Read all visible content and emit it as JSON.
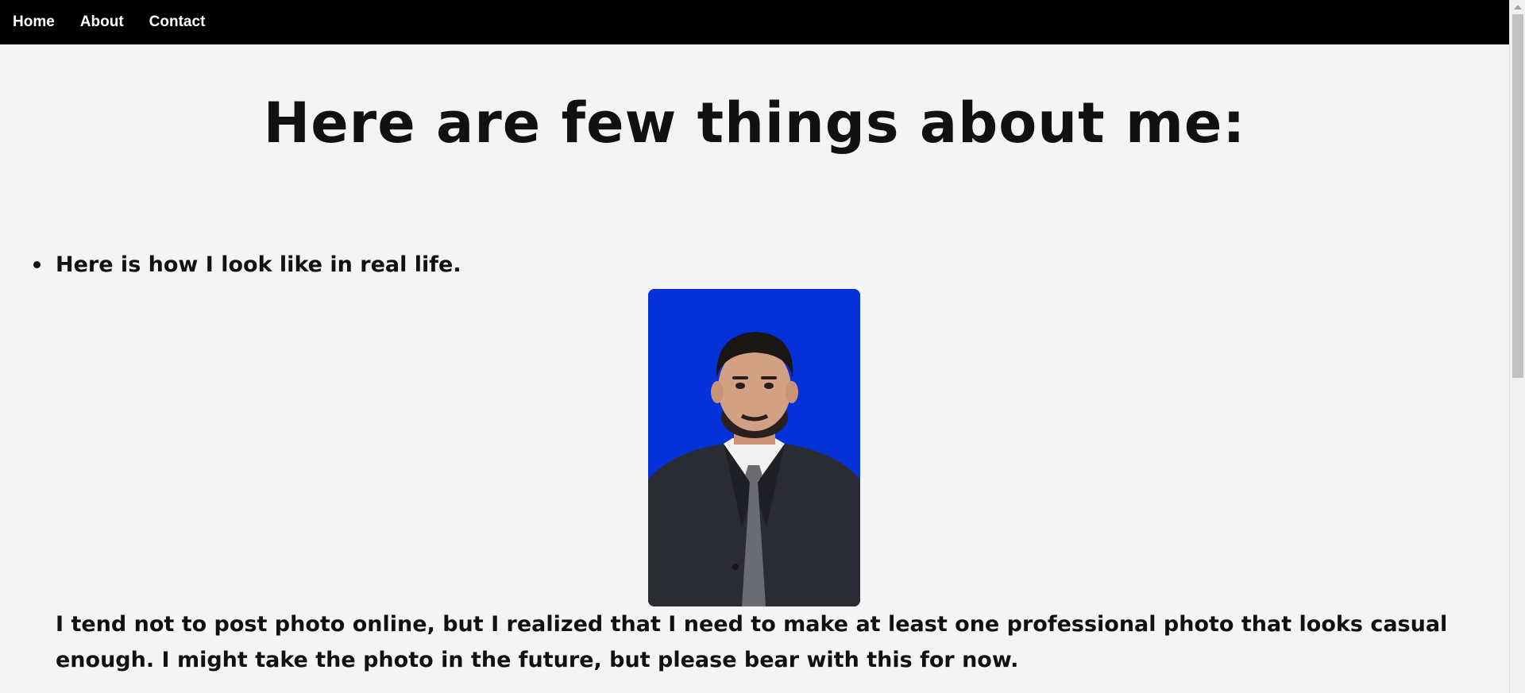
{
  "nav": {
    "items": [
      {
        "label": "Home"
      },
      {
        "label": "About"
      },
      {
        "label": "Contact"
      }
    ]
  },
  "main": {
    "title": "Here are few things about me:",
    "facts": [
      {
        "heading": "Here is how I look like in real life.",
        "photo_icon": "portrait-photo",
        "description": "I tend not to post photo online, but I realized that I need to make at least one professional photo that looks casual enough. I might take the photo in the future, but please bear with this for now."
      }
    ]
  },
  "colors": {
    "nav_background": "#000000",
    "nav_text": "#ffffff",
    "page_background": "#f4f4f4",
    "photo_background": "#0532d8"
  }
}
